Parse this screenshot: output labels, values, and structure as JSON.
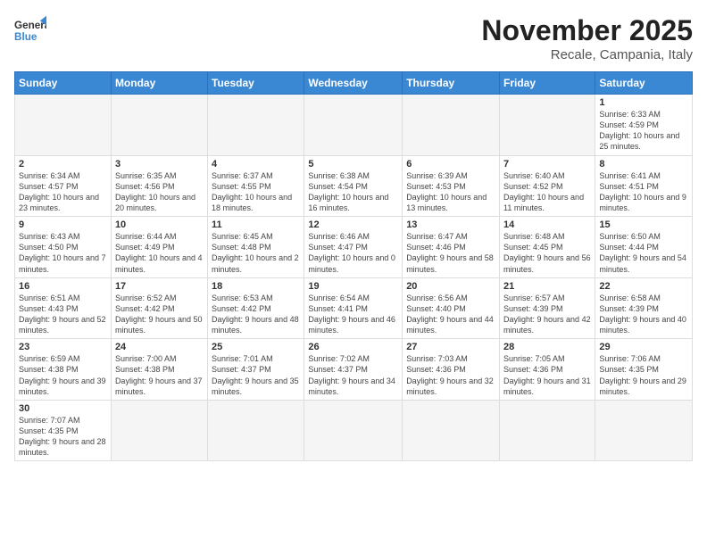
{
  "header": {
    "logo_general": "General",
    "logo_blue": "Blue",
    "month_title": "November 2025",
    "location": "Recale, Campania, Italy"
  },
  "weekdays": [
    "Sunday",
    "Monday",
    "Tuesday",
    "Wednesday",
    "Thursday",
    "Friday",
    "Saturday"
  ],
  "weeks": [
    [
      {
        "day": "",
        "info": ""
      },
      {
        "day": "",
        "info": ""
      },
      {
        "day": "",
        "info": ""
      },
      {
        "day": "",
        "info": ""
      },
      {
        "day": "",
        "info": ""
      },
      {
        "day": "",
        "info": ""
      },
      {
        "day": "1",
        "info": "Sunrise: 6:33 AM\nSunset: 4:59 PM\nDaylight: 10 hours and 25 minutes."
      }
    ],
    [
      {
        "day": "2",
        "info": "Sunrise: 6:34 AM\nSunset: 4:57 PM\nDaylight: 10 hours and 23 minutes."
      },
      {
        "day": "3",
        "info": "Sunrise: 6:35 AM\nSunset: 4:56 PM\nDaylight: 10 hours and 20 minutes."
      },
      {
        "day": "4",
        "info": "Sunrise: 6:37 AM\nSunset: 4:55 PM\nDaylight: 10 hours and 18 minutes."
      },
      {
        "day": "5",
        "info": "Sunrise: 6:38 AM\nSunset: 4:54 PM\nDaylight: 10 hours and 16 minutes."
      },
      {
        "day": "6",
        "info": "Sunrise: 6:39 AM\nSunset: 4:53 PM\nDaylight: 10 hours and 13 minutes."
      },
      {
        "day": "7",
        "info": "Sunrise: 6:40 AM\nSunset: 4:52 PM\nDaylight: 10 hours and 11 minutes."
      },
      {
        "day": "8",
        "info": "Sunrise: 6:41 AM\nSunset: 4:51 PM\nDaylight: 10 hours and 9 minutes."
      }
    ],
    [
      {
        "day": "9",
        "info": "Sunrise: 6:43 AM\nSunset: 4:50 PM\nDaylight: 10 hours and 7 minutes."
      },
      {
        "day": "10",
        "info": "Sunrise: 6:44 AM\nSunset: 4:49 PM\nDaylight: 10 hours and 4 minutes."
      },
      {
        "day": "11",
        "info": "Sunrise: 6:45 AM\nSunset: 4:48 PM\nDaylight: 10 hours and 2 minutes."
      },
      {
        "day": "12",
        "info": "Sunrise: 6:46 AM\nSunset: 4:47 PM\nDaylight: 10 hours and 0 minutes."
      },
      {
        "day": "13",
        "info": "Sunrise: 6:47 AM\nSunset: 4:46 PM\nDaylight: 9 hours and 58 minutes."
      },
      {
        "day": "14",
        "info": "Sunrise: 6:48 AM\nSunset: 4:45 PM\nDaylight: 9 hours and 56 minutes."
      },
      {
        "day": "15",
        "info": "Sunrise: 6:50 AM\nSunset: 4:44 PM\nDaylight: 9 hours and 54 minutes."
      }
    ],
    [
      {
        "day": "16",
        "info": "Sunrise: 6:51 AM\nSunset: 4:43 PM\nDaylight: 9 hours and 52 minutes."
      },
      {
        "day": "17",
        "info": "Sunrise: 6:52 AM\nSunset: 4:42 PM\nDaylight: 9 hours and 50 minutes."
      },
      {
        "day": "18",
        "info": "Sunrise: 6:53 AM\nSunset: 4:42 PM\nDaylight: 9 hours and 48 minutes."
      },
      {
        "day": "19",
        "info": "Sunrise: 6:54 AM\nSunset: 4:41 PM\nDaylight: 9 hours and 46 minutes."
      },
      {
        "day": "20",
        "info": "Sunrise: 6:56 AM\nSunset: 4:40 PM\nDaylight: 9 hours and 44 minutes."
      },
      {
        "day": "21",
        "info": "Sunrise: 6:57 AM\nSunset: 4:39 PM\nDaylight: 9 hours and 42 minutes."
      },
      {
        "day": "22",
        "info": "Sunrise: 6:58 AM\nSunset: 4:39 PM\nDaylight: 9 hours and 40 minutes."
      }
    ],
    [
      {
        "day": "23",
        "info": "Sunrise: 6:59 AM\nSunset: 4:38 PM\nDaylight: 9 hours and 39 minutes."
      },
      {
        "day": "24",
        "info": "Sunrise: 7:00 AM\nSunset: 4:38 PM\nDaylight: 9 hours and 37 minutes."
      },
      {
        "day": "25",
        "info": "Sunrise: 7:01 AM\nSunset: 4:37 PM\nDaylight: 9 hours and 35 minutes."
      },
      {
        "day": "26",
        "info": "Sunrise: 7:02 AM\nSunset: 4:37 PM\nDaylight: 9 hours and 34 minutes."
      },
      {
        "day": "27",
        "info": "Sunrise: 7:03 AM\nSunset: 4:36 PM\nDaylight: 9 hours and 32 minutes."
      },
      {
        "day": "28",
        "info": "Sunrise: 7:05 AM\nSunset: 4:36 PM\nDaylight: 9 hours and 31 minutes."
      },
      {
        "day": "29",
        "info": "Sunrise: 7:06 AM\nSunset: 4:35 PM\nDaylight: 9 hours and 29 minutes."
      }
    ],
    [
      {
        "day": "30",
        "info": "Sunrise: 7:07 AM\nSunset: 4:35 PM\nDaylight: 9 hours and 28 minutes."
      },
      {
        "day": "",
        "info": ""
      },
      {
        "day": "",
        "info": ""
      },
      {
        "day": "",
        "info": ""
      },
      {
        "day": "",
        "info": ""
      },
      {
        "day": "",
        "info": ""
      },
      {
        "day": "",
        "info": ""
      }
    ]
  ]
}
